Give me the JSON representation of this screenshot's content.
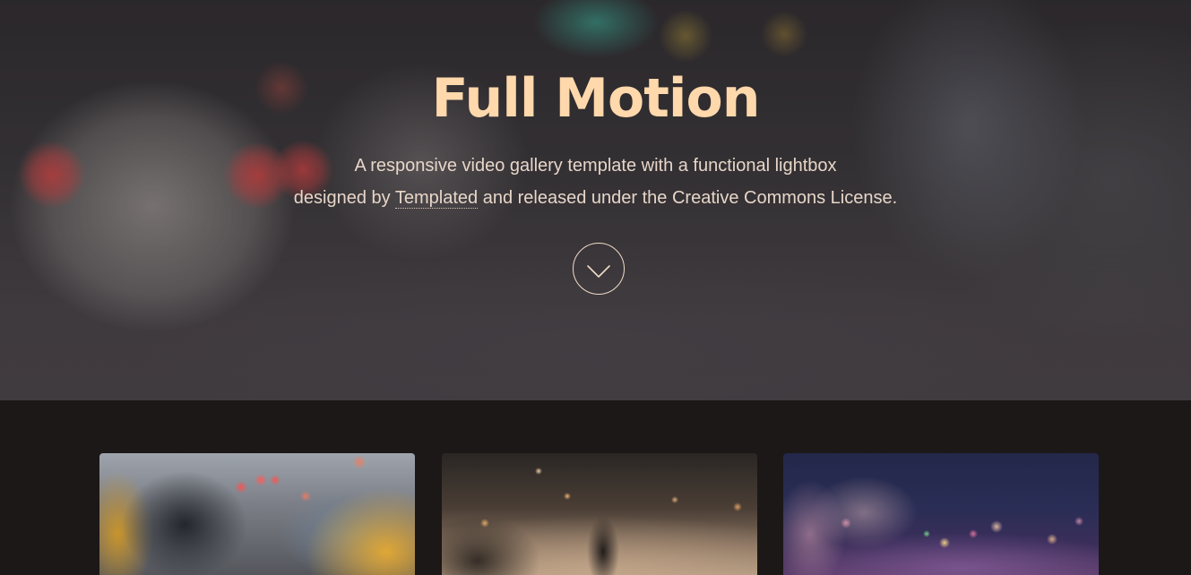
{
  "hero": {
    "title": "Full Motion",
    "subtitle_line1": "A responsive video gallery template with a functional lightbox",
    "subtitle_line2_before": "designed by ",
    "subtitle_link": "Templated",
    "subtitle_line2_after": " and released under the Creative Commons License.",
    "scroll_icon": "chevron-down-icon"
  },
  "colors": {
    "title": "#ffd8ac",
    "subtitle": "#e7d6c9",
    "gallery_bg": "#1c1817"
  },
  "gallery": {
    "thumbnails": [
      {
        "name": "gallery-thumbnail-taxi-traffic"
      },
      {
        "name": "gallery-thumbnail-city-crossing"
      },
      {
        "name": "gallery-thumbnail-city-lights"
      }
    ]
  }
}
